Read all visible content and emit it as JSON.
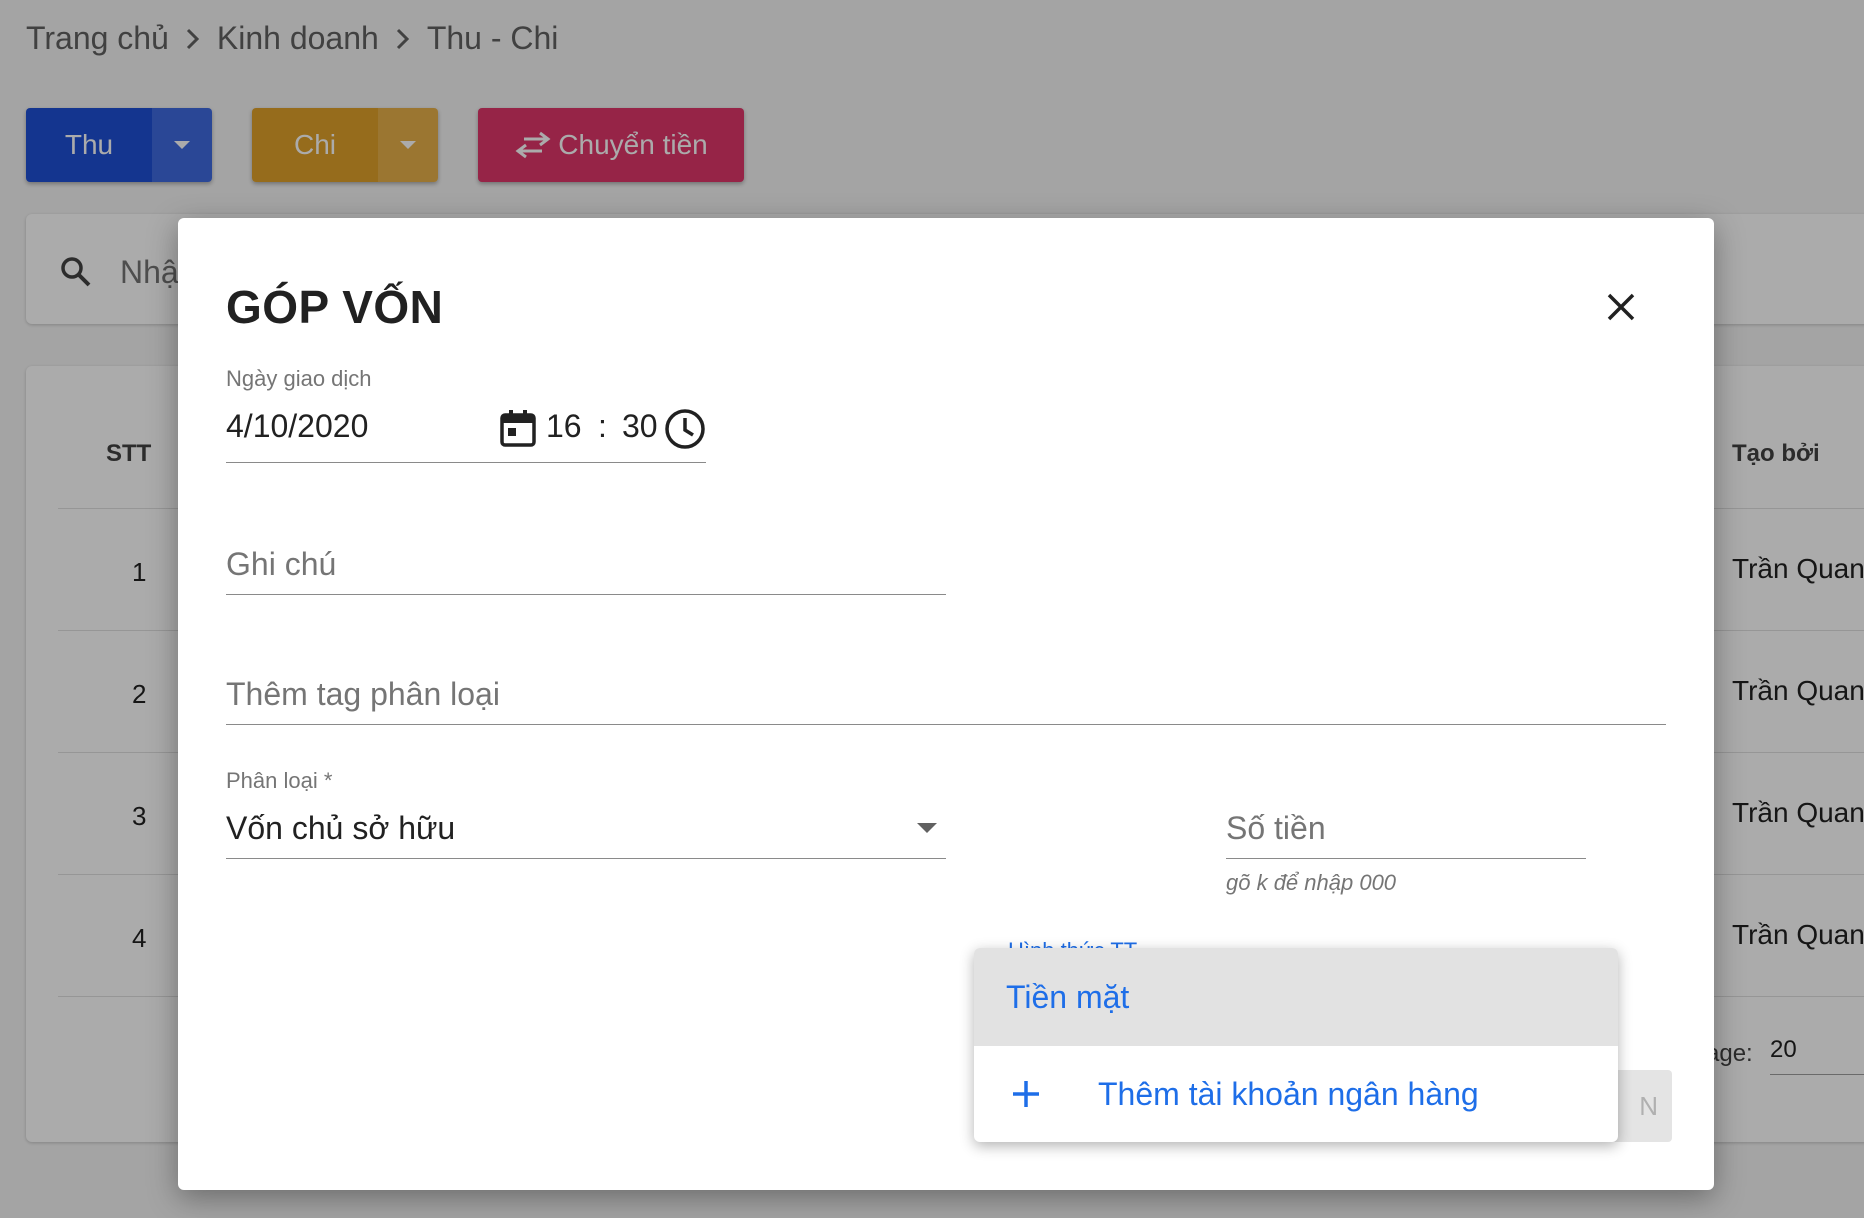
{
  "breadcrumb": [
    "Trang chủ",
    "Kinh doanh",
    "Thu - Chi"
  ],
  "toolbar": {
    "thu_label": "Thu",
    "chi_label": "Chi",
    "transfer_label": "Chuyển tiền"
  },
  "search": {
    "placeholder": "Nhậ"
  },
  "table": {
    "headers": {
      "stt": "STT",
      "created_by": "Tạo bởi"
    },
    "rows": [
      {
        "stt": "1",
        "created_by": "Trần Quang"
      },
      {
        "stt": "2",
        "created_by": "Trần Quang"
      },
      {
        "stt": "3",
        "created_by": "Trần Quang"
      },
      {
        "stt": "4",
        "created_by": "Trần Quang"
      }
    ],
    "rows_per_page_label": "age:",
    "rows_per_page_value": "20"
  },
  "dialog": {
    "title": "GÓP VỐN",
    "date_label": "Ngày giao dịch",
    "date_value": "4/10/2020",
    "hour": "16",
    "minute": "30",
    "note_placeholder": "Ghi chú",
    "tag_placeholder": "Thêm tag phân loại",
    "category_label": "Phân loại *",
    "category_value": "Vốn chủ sở hữu",
    "amount_placeholder": "Số tiền",
    "amount_hint": "gõ k để nhập 000",
    "payment_label": "Hình thức TT",
    "save_label": "N"
  },
  "payment_menu": {
    "options": [
      "Tiền mặt"
    ],
    "add_bank_label": "Thêm tài khoản ngân hàng"
  },
  "colors": {
    "thu": "#1e4fd6",
    "chi": "#e0a22a",
    "transfer": "#e0366a",
    "link": "#1e6ee8"
  }
}
